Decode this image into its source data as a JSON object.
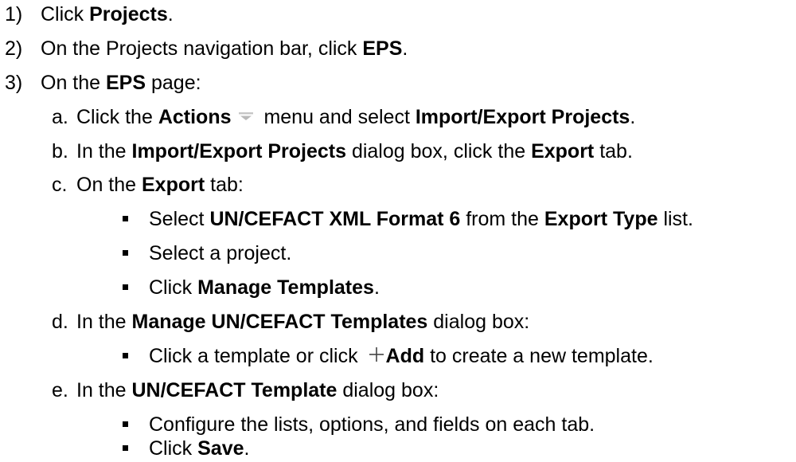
{
  "steps": [
    {
      "num": "1)",
      "pre": "Click ",
      "b1": "Projects",
      "post": "."
    },
    {
      "num": "2)",
      "pre": "On the Projects navigation bar, click ",
      "b1": "EPS",
      "post": "."
    },
    {
      "num": "3)",
      "pre": "On the ",
      "b1": "EPS",
      "post": " page:"
    }
  ],
  "substeps": {
    "a": {
      "num": "a.",
      "pre": "Click the ",
      "b1": "Actions",
      "mid": " menu and select ",
      "b2": "Import/Export Projects",
      "post": "."
    },
    "b": {
      "num": "b.",
      "pre": "In the ",
      "b1": "Import/Export Projects",
      "mid": " dialog box, click the ",
      "b2": "Export",
      "post": " tab."
    },
    "c": {
      "num": "c.",
      "pre": "On the ",
      "b1": "Export",
      "post": " tab:"
    },
    "d": {
      "num": "d.",
      "pre": "In the ",
      "b1": "Manage UN/CEFACT Templates",
      "post": " dialog box:"
    },
    "e": {
      "num": "e.",
      "pre": "In the ",
      "b1": "UN/CEFACT Template",
      "post": " dialog box:"
    }
  },
  "bullets_c": [
    {
      "pre": "Select ",
      "b1": "UN/CEFACT XML Format 6",
      "mid": " from the ",
      "b2": "Export Type",
      "post": " list."
    },
    {
      "pre": "Select a project.",
      "b1": "",
      "mid": "",
      "b2": "",
      "post": ""
    },
    {
      "pre": "Click ",
      "b1": "Manage Templates",
      "mid": "",
      "b2": "",
      "post": "."
    }
  ],
  "bullets_d": [
    {
      "pre": "Click a template or click ",
      "b1": "Add",
      "post": " to create a new template."
    }
  ],
  "bullets_e": [
    {
      "pre": "Configure the lists, options, and fields on each tab.",
      "b1": "",
      "post": ""
    },
    {
      "pre": "Click ",
      "b1": "Save",
      "post": "."
    }
  ],
  "icons": {
    "actions_dropdown": "chevron-down-icon",
    "add": "plus-icon",
    "dropdown_color": "#b9b9b9",
    "plus_color": "#444444"
  }
}
